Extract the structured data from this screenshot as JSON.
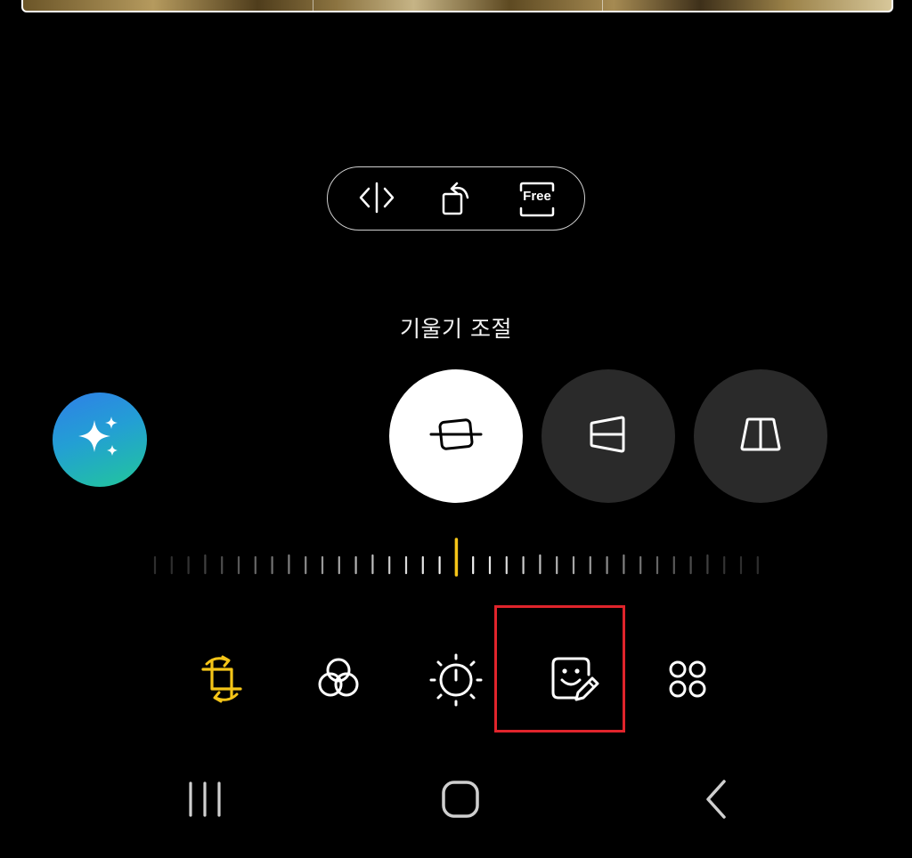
{
  "transform": {
    "flip_icon": "flip-horizontal-icon",
    "rotate_icon": "rotate-icon",
    "ratio_label": "Free"
  },
  "tilt": {
    "label": "기울기 조절",
    "active_mode": "straighten",
    "modes": [
      "straighten-icon",
      "vertical-perspective-icon",
      "horizontal-perspective-icon"
    ]
  },
  "colors": {
    "accent": "#f5c518",
    "highlight": "#e0242b",
    "ai_gradient": [
      "#2f7fe8",
      "#21c79a"
    ]
  },
  "tools": [
    {
      "icon": "crop-rotate-icon",
      "active": true
    },
    {
      "icon": "filter-icon",
      "active": false
    },
    {
      "icon": "brightness-icon",
      "active": false
    },
    {
      "icon": "sticker-decoration-icon",
      "active": false
    },
    {
      "icon": "more-tools-icon",
      "active": false
    }
  ],
  "nav": [
    "recent-apps-icon",
    "home-icon",
    "back-icon"
  ]
}
